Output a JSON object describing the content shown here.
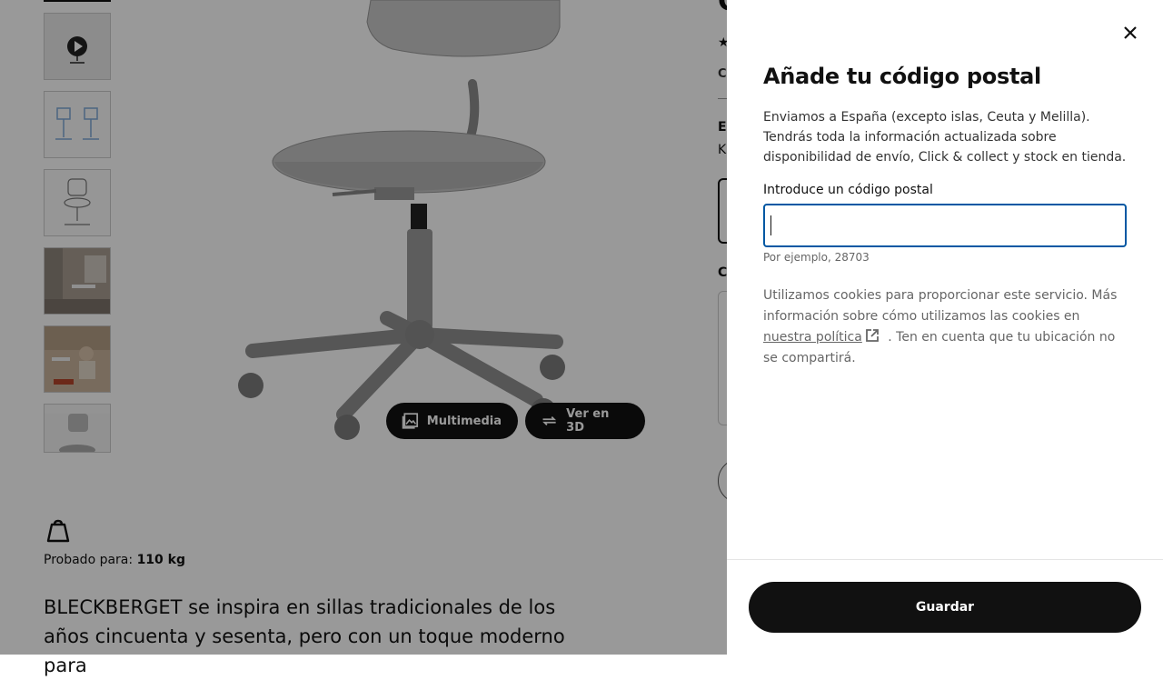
{
  "product": {
    "media_buttons": {
      "multimedia": "Multimedia",
      "view_3d": "Ver en 3D"
    },
    "tested_label": "Probado para:",
    "tested_value": "110 kg",
    "description": "BLECKBERGET se inspira en sillas tradicionales de los años cincuenta y sesenta, pero con un toque moderno para",
    "right_column": {
      "title_fragment": "C",
      "rating_star": "★",
      "co_fragment": "Co",
      "el_fragment": "El",
      "k_fragment": "K",
      "c_fragment": "C"
    }
  },
  "modal": {
    "title": "Añade tu código postal",
    "intro": "Enviamos a España (excepto islas, Ceuta y Melilla). Tendrás toda la información actualizada sobre disponibilidad de envío, Click & collect y stock en tienda.",
    "input_label": "Introduce un código postal",
    "input_value": "",
    "input_hint": "Por ejemplo, 28703",
    "cookies_before": "Utilizamos cookies para proporcionar este servicio. Más información sobre cómo utilizamos las cookies en",
    "cookies_link": "nuestra política",
    "cookies_after": ". Ten en cuenta que tu ubicación no se compartirá.",
    "save_label": "Guardar",
    "close_icon": "close-icon"
  },
  "colors": {
    "accent_focus": "#0058a3",
    "button_bg": "#111111",
    "overlay": "rgba(0,0,0,0.4)"
  }
}
